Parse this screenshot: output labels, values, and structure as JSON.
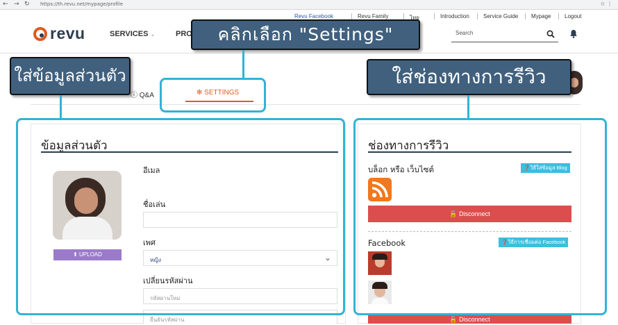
{
  "browser": {
    "url": "https://th.revu.net/mypage/profile"
  },
  "top_links": [
    "Revu Facebook",
    "Revu Family",
    "ไทย",
    "Introduction",
    "Service Guide",
    "Mypage",
    "Logout"
  ],
  "logo_text": "revu",
  "nav": {
    "services": "SERVICES",
    "pro_partial": "PRO",
    "search_placeholder": "Search"
  },
  "tabs": {
    "qa": "Q&A",
    "settings": "SETTINGS"
  },
  "profile_panel": {
    "title": "ข้อมูลส่วนตัว",
    "upload_label": "UPLOAD",
    "email_label": "อีเมล",
    "nickname_label": "ชื่อเล่น",
    "nickname_value": "",
    "gender_label": "เพศ",
    "gender_value": "หญิง",
    "password_label": "เปลี่ยนรหัสผ่าน",
    "new_password_placeholder": "รหัสผ่านใหม่",
    "confirm_password_placeholder": "ยืนยันรหัสผ่าน"
  },
  "channels_panel": {
    "title": "ช่องทางการรีวิว",
    "blog_label": "บล็อก หรือ เว็บไซต์",
    "blog_help": "วิธีใส่ข้อมูล Blog",
    "disconnect_label": "Disconnect",
    "facebook_label": "Facebook",
    "facebook_help": "วิธีการเชื่อมต่อ Facebook"
  },
  "annotations": {
    "settings_callout": "คลิกเลือก \"Settings\"",
    "profile_callout": "ใส่ข้อมูลส่วนตัว",
    "channels_callout": "ใส่ช่องทางการรีวิว"
  },
  "colors": {
    "brand_orange": "#e05a1d",
    "navy": "#2c3e50",
    "disconnect_red": "#dc4e4e",
    "help_cyan": "#3bbfdc",
    "upload_purple": "#9b7bc9",
    "callout_fill": "#40607e",
    "callout_frame": "#31b3d6"
  }
}
